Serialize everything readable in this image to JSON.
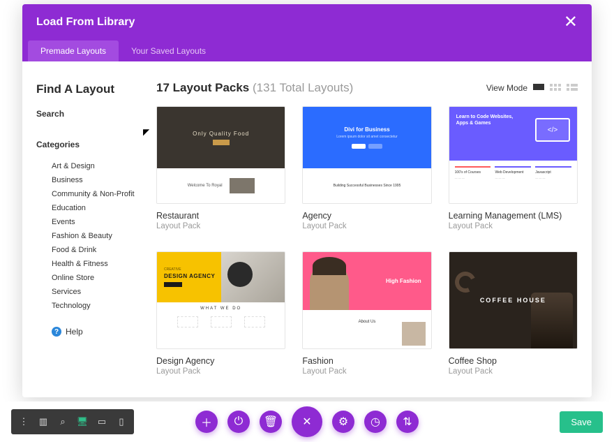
{
  "modal": {
    "title": "Load From Library",
    "tabs": [
      {
        "label": "Premade Layouts",
        "active": true
      },
      {
        "label": "Your Saved Layouts",
        "active": false
      }
    ]
  },
  "sidebar": {
    "heading": "Find A Layout",
    "search_label": "Search",
    "categories_label": "Categories",
    "categories": [
      "Art & Design",
      "Business",
      "Community & Non-Profit",
      "Education",
      "Events",
      "Fashion & Beauty",
      "Food & Drink",
      "Health & Fitness",
      "Online Store",
      "Services",
      "Technology"
    ],
    "help_label": "Help"
  },
  "main": {
    "count": "17",
    "title_suffix": "Layout Packs",
    "total": "(131 Total Layouts)",
    "view_mode_label": "View Mode",
    "cards": [
      {
        "title": "Restaurant",
        "sub": "Layout Pack",
        "thumb": "restaurant",
        "hero_text": "Only Quality Food",
        "below_text": "Welcome To Royal"
      },
      {
        "title": "Agency",
        "sub": "Layout Pack",
        "thumb": "agency",
        "hero_text": "Divi for Business",
        "below_text": "Building Successful Businesses Since 1995"
      },
      {
        "title": "Learning Management (LMS)",
        "sub": "Layout Pack",
        "thumb": "lms",
        "hero_text": "Learn to Code Websites, Apps & Games",
        "below_text": "100's of Courses"
      },
      {
        "title": "Design Agency",
        "sub": "Layout Pack",
        "thumb": "design",
        "hero_text": "DESIGN AGENCY",
        "hero_sub": "CREATIVE",
        "below_text": "WHAT WE DO"
      },
      {
        "title": "Fashion",
        "sub": "Layout Pack",
        "thumb": "fashion",
        "hero_text": "High Fashion",
        "below_text": "About Us"
      },
      {
        "title": "Coffee Shop",
        "sub": "Layout Pack",
        "thumb": "coffee",
        "hero_text": "COFFEE HOUSE"
      }
    ]
  },
  "bottom": {
    "save_label": "Save"
  }
}
